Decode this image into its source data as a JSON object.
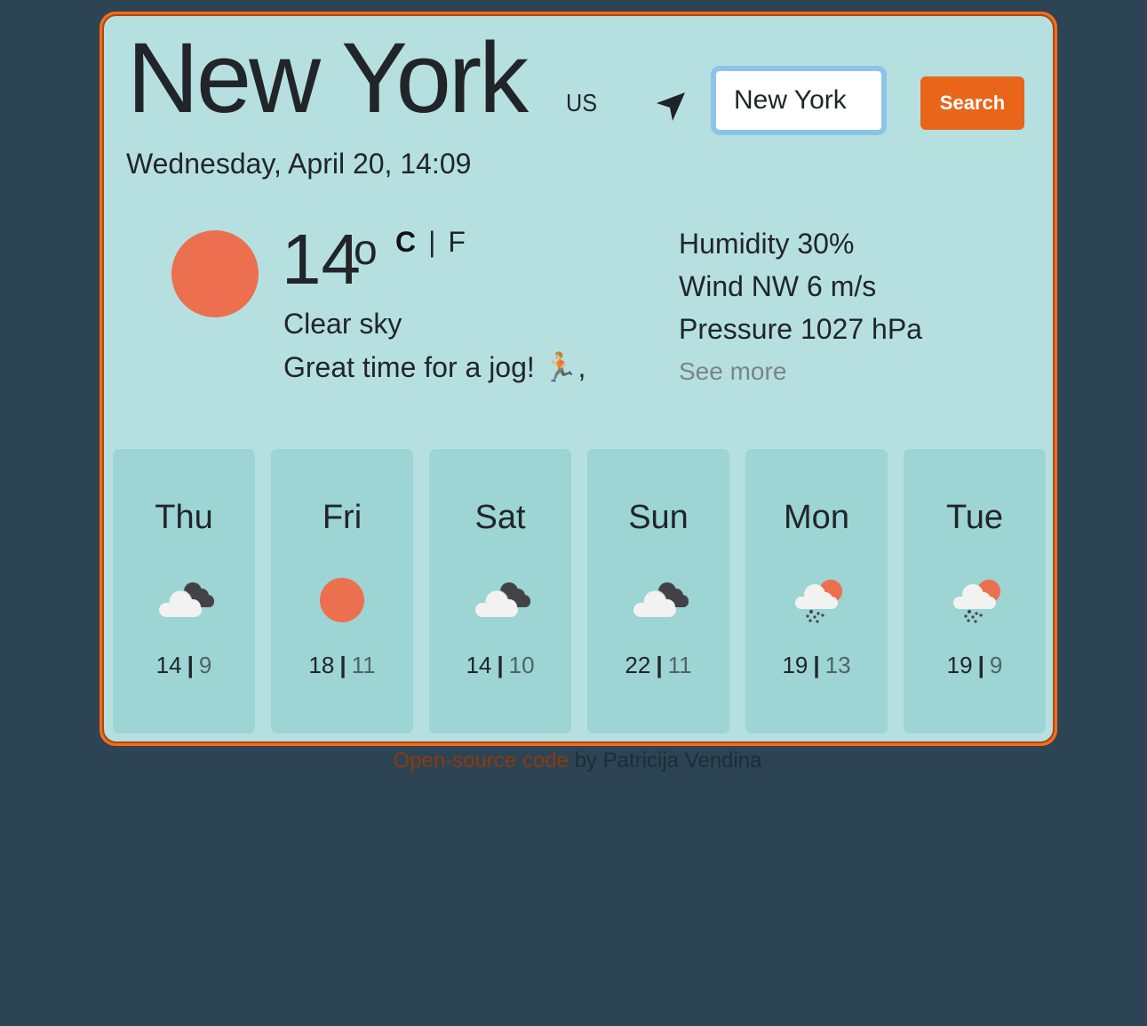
{
  "header": {
    "city": "New York",
    "country": "US",
    "date": "Wednesday, April 20, 14:09",
    "locate_icon": "location-arrow-icon"
  },
  "search": {
    "value": "New York",
    "placeholder": "",
    "button_label": "Search"
  },
  "current": {
    "icon": "sun-icon",
    "temperature": "14",
    "degree_symbol": "o",
    "unit_c": "C",
    "unit_separator": "|",
    "unit_f": "F",
    "description": "Clear sky",
    "advice": "Great time for a jog! 🏃🏼,",
    "humidity": "Humidity 30%",
    "wind": "Wind NW 6 m/s",
    "pressure": "Pressure 1027 hPa",
    "see_more": "See more"
  },
  "forecast": [
    {
      "day": "Thu",
      "icon": "cloudy-icon",
      "max": "14",
      "sep": "|",
      "min": "9"
    },
    {
      "day": "Fri",
      "icon": "sun-icon",
      "max": "18",
      "sep": "|",
      "min": "11"
    },
    {
      "day": "Sat",
      "icon": "cloudy-icon",
      "max": "14",
      "sep": "|",
      "min": "10"
    },
    {
      "day": "Sun",
      "icon": "cloudy-icon",
      "max": "22",
      "sep": "|",
      "min": "11"
    },
    {
      "day": "Mon",
      "icon": "rain-sun-icon",
      "max": "19",
      "sep": "|",
      "min": "13"
    },
    {
      "day": "Tue",
      "icon": "rain-sun-icon",
      "max": "19",
      "sep": "|",
      "min": "9"
    }
  ],
  "footer": {
    "link_text": "Open-source code",
    "rest_text": " by Patricija Vendina"
  },
  "colors": {
    "background": "#2c4454",
    "card": "#b6e0e0",
    "forecast_card": "#9dd4d4",
    "accent": "#e8651a",
    "sun": "#ec6f4f",
    "input_focus": "#8cc3ea"
  }
}
